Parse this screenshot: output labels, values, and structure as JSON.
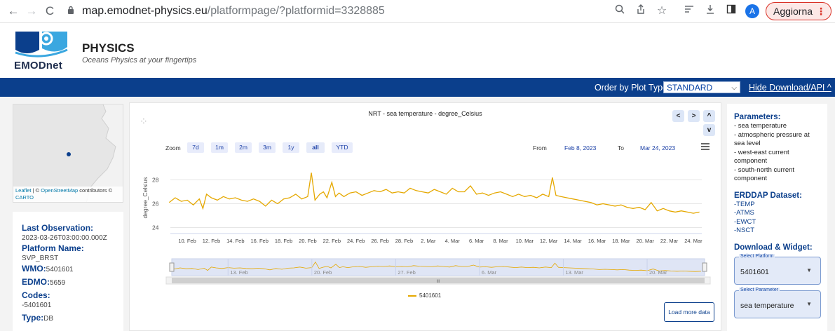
{
  "browser": {
    "url_host": "map.emodnet-physics.eu",
    "url_path": "/platformpage/?platformid=3328885",
    "back_icon": "←",
    "forward_icon": "→",
    "reload_icon": "C",
    "avatar_letter": "A",
    "update_label": "Aggiorna",
    "update_menu_icon": "⋮"
  },
  "site": {
    "logo_text": "EMODnet",
    "title": "PHYSICS",
    "subtitle": "Oceans Physics at your fingertips"
  },
  "toolbar": {
    "order_label": "Order by Plot Type",
    "plot_type": "STANDARD",
    "hide_link": "Hide Download/API ^"
  },
  "map": {
    "attr_leaflet": "Leaflet",
    "attr_sep": " | © ",
    "attr_osm": "OpenStreetMap",
    "attr_rest": " contributors ©",
    "attr_carto": "CARTO"
  },
  "info": {
    "last_obs_label": "Last Observation:",
    "last_obs_value": "2023-03-26T03:00:00.000Z",
    "platform_name_label": "Platform Name:",
    "platform_name_value": "SVP_BRST",
    "wmo_label": "WMO:",
    "wmo_value": "5401601",
    "edmo_label": "EDMO:",
    "edmo_value": "5659",
    "codes_label": "Codes:",
    "codes_value": "-5401601",
    "type_label": "Type:",
    "type_value": "DB"
  },
  "chart": {
    "zoom_label": "Zoom",
    "zoom_buttons": [
      "7d",
      "1m",
      "2m",
      "3m",
      "1y",
      "all",
      "YTD"
    ],
    "from_label": "From",
    "from_value": "Feb 8, 2023",
    "to_label": "To",
    "to_value": "Mar 24, 2023",
    "load_more": "Load more data",
    "nav_prev": "<",
    "nav_next": ">",
    "nav_up": "^",
    "nav_down": "v",
    "navigator_scroll": "III"
  },
  "chart_data": {
    "type": "line",
    "title": "NRT - sea temperature - degree_Celsius",
    "ylabel": "degree_Celsius",
    "xlabel": "",
    "ylim": [
      23.5,
      29.5
    ],
    "yticks": [
      24,
      26,
      28
    ],
    "xtick_labels": [
      "10. Feb",
      "12. Feb",
      "14. Feb",
      "16. Feb",
      "18. Feb",
      "20. Feb",
      "22. Feb",
      "24. Feb",
      "26. Feb",
      "28. Feb",
      "2. Mar",
      "4. Mar",
      "6. Mar",
      "8. Mar",
      "10. Mar",
      "12. Mar",
      "14. Mar",
      "16. Mar",
      "18. Mar",
      "20. Mar",
      "22. Mar",
      "24. Mar"
    ],
    "navigator_labels": [
      "13. Feb",
      "20. Feb",
      "27. Feb",
      "6. Mar",
      "13. Mar",
      "20. Mar"
    ],
    "series": [
      {
        "name": "5401601",
        "color": "#e5a800",
        "x": [
          8.5,
          9.0,
          9.5,
          10.0,
          10.5,
          11.0,
          11.3,
          11.6,
          12.0,
          12.5,
          13.0,
          13.5,
          14.0,
          14.5,
          15.0,
          15.5,
          16.0,
          16.5,
          17.0,
          17.5,
          18.0,
          18.5,
          19.0,
          19.5,
          20.0,
          20.3,
          20.6,
          21.0,
          21.3,
          21.6,
          22.0,
          22.3,
          22.6,
          23.0,
          23.5,
          24.0,
          24.5,
          25.0,
          25.5,
          26.0,
          26.5,
          27.0,
          27.5,
          28.0,
          28.5,
          29.0,
          29.5,
          30.0,
          30.5,
          31.0,
          31.5,
          32.0,
          32.5,
          33.0,
          33.5,
          34.0,
          34.5,
          35.0,
          35.5,
          36.0,
          36.5,
          37.0,
          37.5,
          38.0,
          38.5,
          39.0,
          39.5,
          40.0,
          40.3,
          40.6,
          41.0,
          41.5,
          42.0,
          42.5,
          43.0,
          43.5,
          44.0,
          44.5,
          45.0,
          45.5,
          46.0,
          46.5,
          47.0,
          47.5,
          48.0,
          48.5,
          49.0,
          49.5,
          50.0,
          50.5,
          51.0,
          51.5,
          52.0,
          52.5
        ],
        "y": [
          26.1,
          26.5,
          26.2,
          26.3,
          25.9,
          26.4,
          25.6,
          26.8,
          26.5,
          26.3,
          26.6,
          26.4,
          26.5,
          26.3,
          26.2,
          26.4,
          26.2,
          25.8,
          26.3,
          26.0,
          26.4,
          26.5,
          26.8,
          26.4,
          26.6,
          28.6,
          26.3,
          26.8,
          27.0,
          26.5,
          27.8,
          26.6,
          26.9,
          26.6,
          26.9,
          27.0,
          26.7,
          26.9,
          27.1,
          27.0,
          27.2,
          26.9,
          27.0,
          26.9,
          27.3,
          27.1,
          27.0,
          26.9,
          27.2,
          27.0,
          26.8,
          27.3,
          27.0,
          27.0,
          27.5,
          26.8,
          26.9,
          26.7,
          26.9,
          27.0,
          26.8,
          26.6,
          26.8,
          26.6,
          26.7,
          26.5,
          26.8,
          26.6,
          28.2,
          26.7,
          26.6,
          26.5,
          26.4,
          26.3,
          26.2,
          26.1,
          25.9,
          26.0,
          25.9,
          25.8,
          25.9,
          25.7,
          25.6,
          25.7,
          25.5,
          26.1,
          25.4,
          25.6,
          25.4,
          25.3,
          25.4,
          25.3,
          25.2,
          25.3
        ]
      }
    ]
  },
  "sidebar": {
    "parameters_title": "Parameters:",
    "parameters": [
      "- sea temperature",
      "- atmospheric pressure at",
      "sea level",
      "- west-east current",
      "component",
      "- south-north current",
      "component"
    ],
    "erddap_title": "ERDDAP Dataset:",
    "datasets": [
      "-TEMP",
      "-ATMS",
      "-EWCT",
      "-NSCT"
    ],
    "download_title": "Download & Widget:",
    "platform_select_label": "Select Platform",
    "platform_select_value": "5401601",
    "parameter_select_label": "Select Parameter",
    "parameter_select_value": "sea temperature"
  }
}
